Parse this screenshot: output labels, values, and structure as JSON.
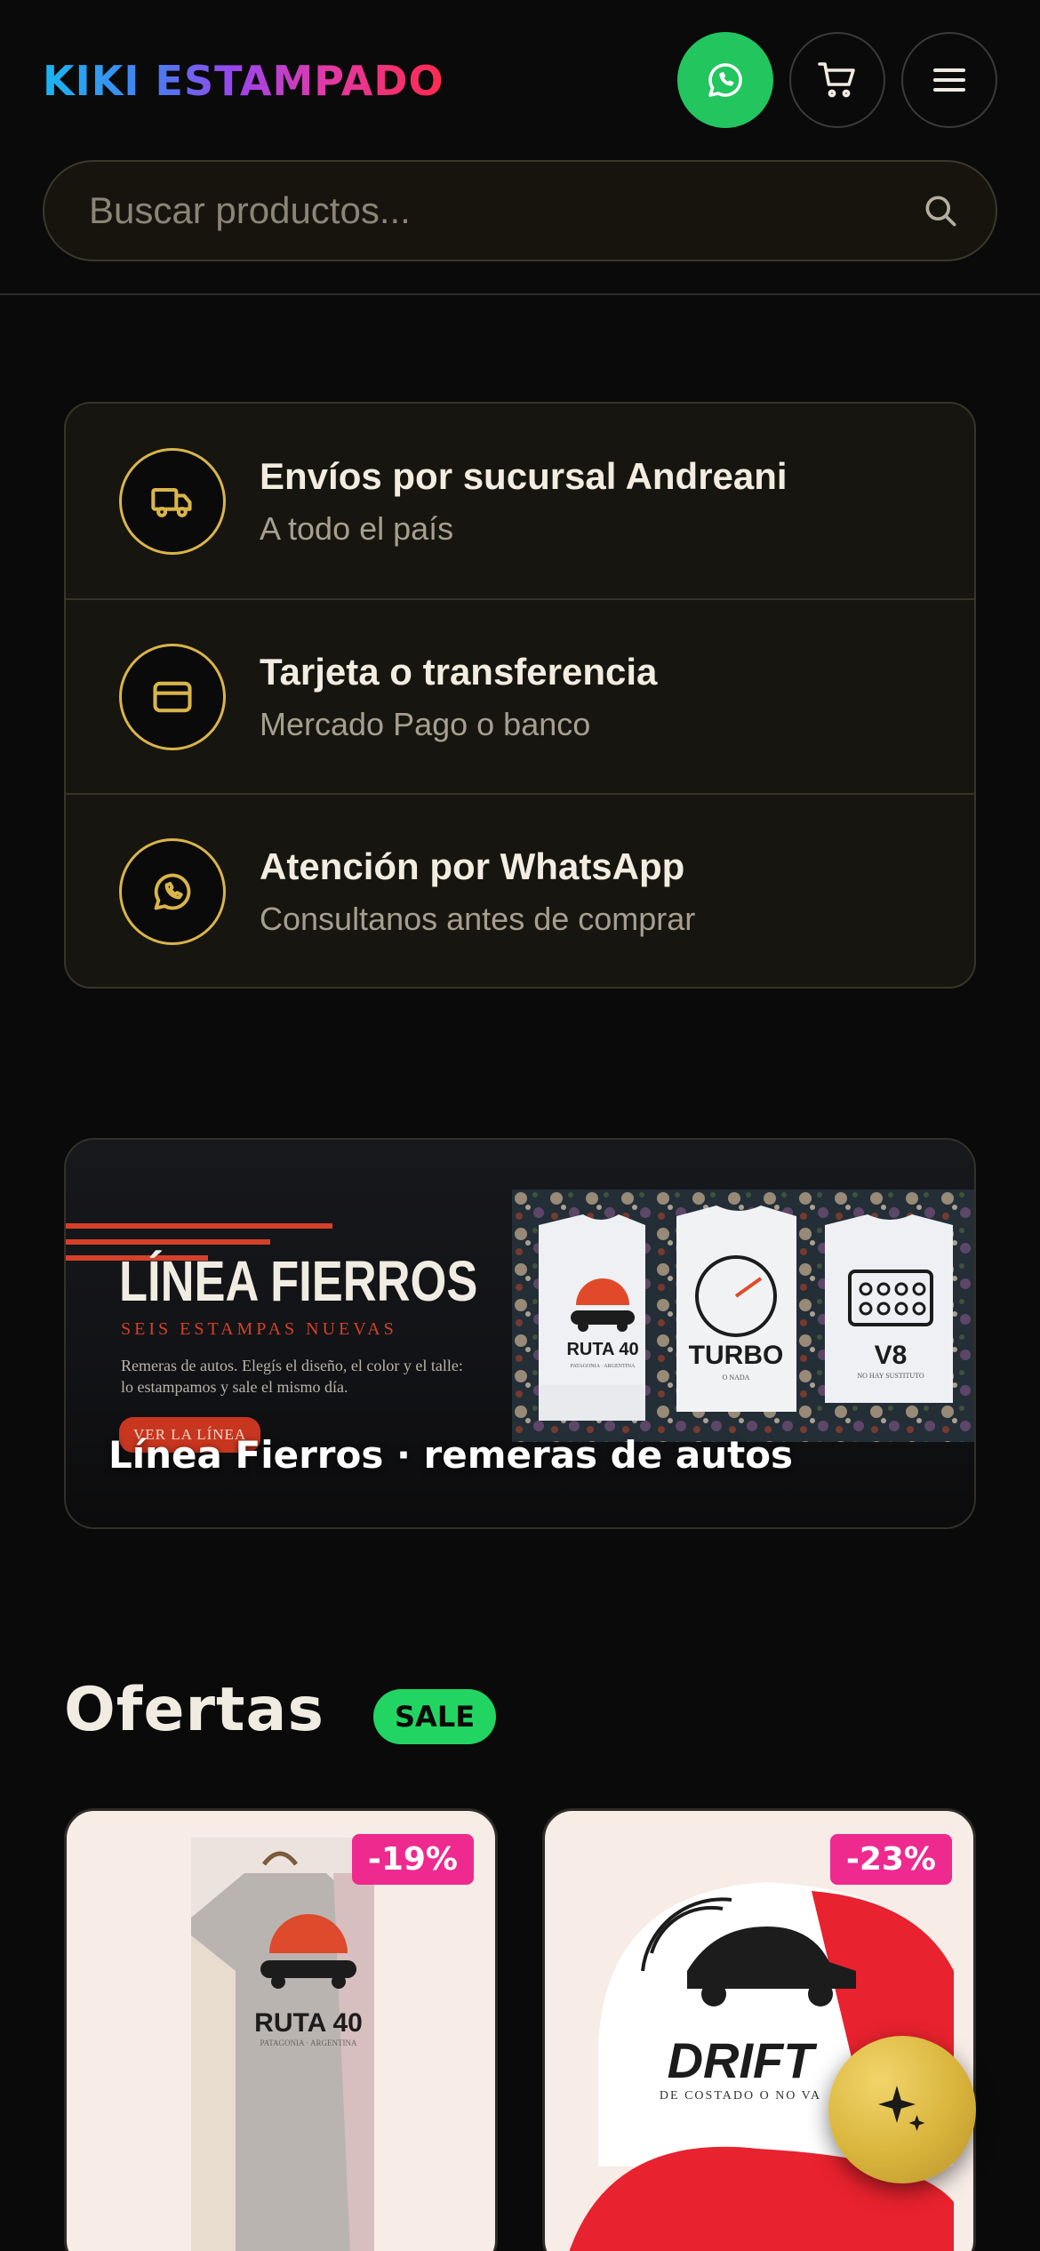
{
  "header": {
    "logo": "KIKI ESTAMPADO",
    "whatsapp_icon": "whatsapp-icon",
    "cart_icon": "cart-icon",
    "menu_icon": "menu-icon"
  },
  "search": {
    "placeholder": "Buscar productos...",
    "icon": "search-icon"
  },
  "features": [
    {
      "icon": "truck-icon",
      "title": "Envíos por sucursal Andreani",
      "subtitle": "A todo el país"
    },
    {
      "icon": "credit-card-icon",
      "title": "Tarjeta o transferencia",
      "subtitle": "Mercado Pago o banco"
    },
    {
      "icon": "whatsapp-icon",
      "title": "Atención por WhatsApp",
      "subtitle": "Consultanos antes de comprar"
    }
  ],
  "banner": {
    "title": "LÍNEA FIERROS",
    "subtitle": "SEIS ESTAMPAS NUEVAS",
    "description": "Remeras de autos. Elegís el diseño, el color y el talle: lo estampamos y sale el mismo día.",
    "button": "VER LA LÍNEA",
    "caption": "Línea Fierros · remeras de autos",
    "shirts": [
      "RUTA 40",
      "TURBO",
      "V8"
    ],
    "shirt_taglines": [
      "PATAGONIA · ARGENTINA",
      "O NADA",
      "NO HAY SUSTITUTO"
    ],
    "accent": "#d6402a"
  },
  "ofertas": {
    "title": "Ofertas",
    "badge": "SALE",
    "products": [
      {
        "discount": "-19%",
        "print_text": "RUTA 40",
        "print_tagline": "PATAGONIA · ARGENTINA"
      },
      {
        "discount": "-23%",
        "print_text": "DRIFT",
        "print_tagline": "DE COSTADO O NO VA"
      }
    ]
  },
  "fab": {
    "icon": "sparkle-icon"
  },
  "colors": {
    "background": "#0a0a0a",
    "gold": "#d9b54a",
    "whatsapp_green": "#22c55e",
    "discount_pink": "#ee2a8f",
    "sale_green": "#22d563"
  }
}
